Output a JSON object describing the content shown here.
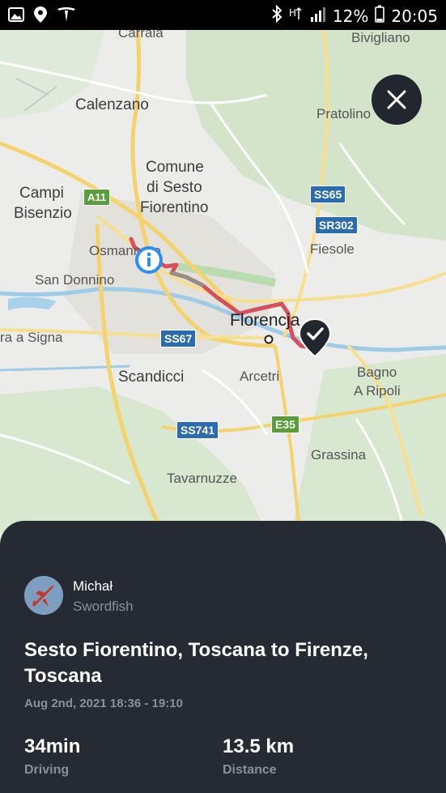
{
  "status_bar": {
    "battery": "12%",
    "time": "20:05",
    "icons": [
      "image-icon",
      "location-pin-icon",
      "tesla-logo-icon",
      "bluetooth-icon",
      "data-icon",
      "signal-icon",
      "battery-icon"
    ]
  },
  "map": {
    "labels": {
      "carraia": "Carraia",
      "bivigliano": "Bivigliano",
      "calenzano": "Calenzano",
      "pratolino": "Pratolino",
      "comune1": "Comune",
      "comune2": "di Sesto",
      "comune3": "Fiorentino",
      "campi1": "Campi",
      "campi2": "Bisenzio",
      "osmannoro": "Osmannoro",
      "fiesole": "Fiesole",
      "san_donnino": "San Donnino",
      "lastra": "ra a Signa",
      "florencja": "Florencja",
      "scandicci": "Scandicci",
      "arcetri": "Arcetri",
      "bagno1": "Bagno",
      "bagno2": "A Ripoli",
      "grassina": "Grassina",
      "tavarnuzze": "Tavarnuzze"
    },
    "shields": {
      "a11": "A11",
      "ss65": "SS65",
      "sr302": "SR302",
      "ss67": "SS67",
      "e35": "E35",
      "ss741": "SS741"
    },
    "route_color": "#d84e5a",
    "start_marker_color": "#2a8ff0",
    "end_marker_color": "#22262e"
  },
  "close_button_icon": "close-icon",
  "trip": {
    "user_name": "Michał",
    "vehicle_name": "Swordfish",
    "title": "Sesto Fiorentino, Toscana to Firenze, Toscana",
    "datetime": "Aug 2nd, 2021 18:36 - 19:10",
    "duration_value": "34min",
    "duration_label": "Driving",
    "distance_value": "13.5 km",
    "distance_label": "Distance"
  },
  "colors": {
    "sheet_background": "#262a33",
    "secondary_text": "#8a8f99"
  }
}
